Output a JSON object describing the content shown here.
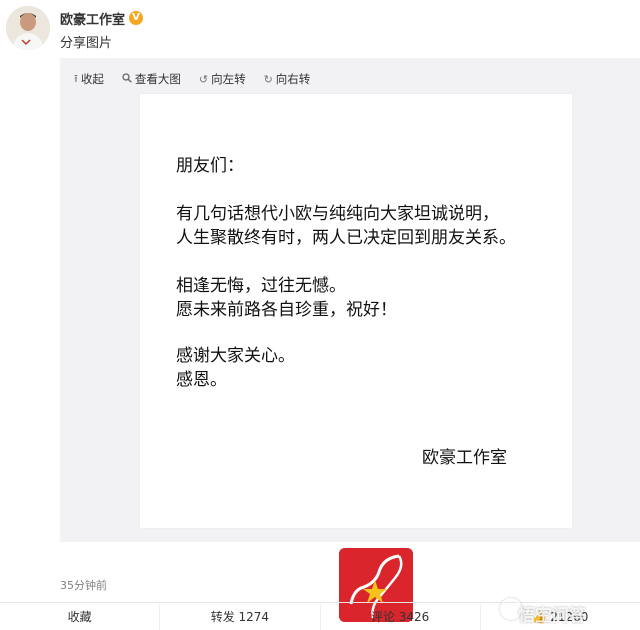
{
  "header": {
    "author_name": "欧豪工作室",
    "verified_icon": "verified-badge-icon",
    "post_type": "分享图片"
  },
  "toolbar": {
    "collapse": "收起",
    "view_large": "查看大图",
    "rotate_left": "向左转",
    "rotate_right": "向右转"
  },
  "letter": {
    "salutation": "朋友们：",
    "paragraph1": [
      "有几句话想代小欧与纯纯向大家坦诚说明，",
      "人生聚散终有时，两人已决定回到朋友关系。"
    ],
    "paragraph2": [
      "相逢无悔，过往无憾。",
      "愿未来前路各自珍重，祝好！"
    ],
    "paragraph3": [
      "感谢大家关心。",
      "感恩。"
    ],
    "signature": "欧豪工作室"
  },
  "post": {
    "timestamp": "35分钟前"
  },
  "actions": {
    "favorite": "收藏",
    "repost": "转发 1274",
    "comment": "评论 3426",
    "like": "21260"
  },
  "watermark": {
    "text": "悟空问答"
  },
  "colors": {
    "watermark_red": "#d9252b",
    "verified_gold": "#f6a623",
    "viewer_bg": "#f2f2f5"
  }
}
